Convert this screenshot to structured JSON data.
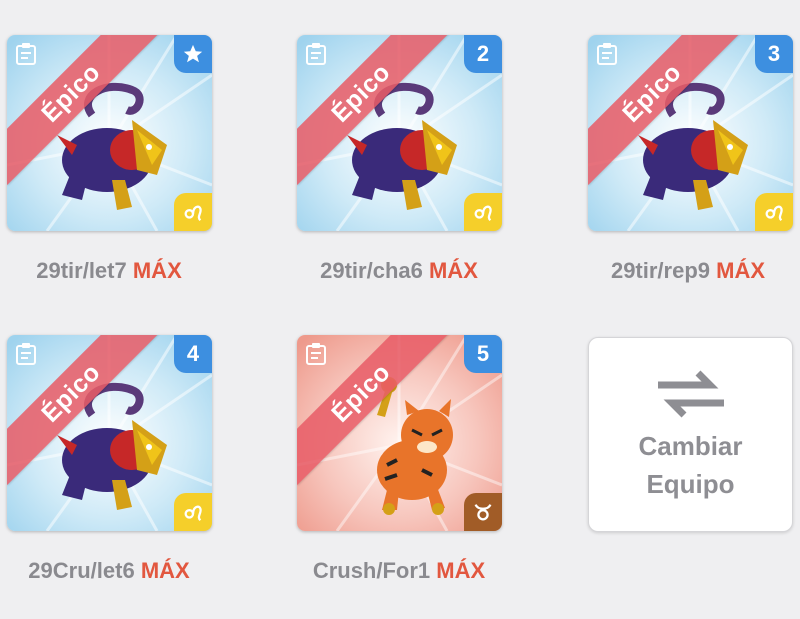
{
  "cards": [
    {
      "rarity": "Épico",
      "badge_type": "star",
      "badge_text": "",
      "element": "leo",
      "name": "29tir/let7",
      "level": "MÁX",
      "theme": "blue",
      "creature": "dark-panther"
    },
    {
      "rarity": "Épico",
      "badge_type": "number",
      "badge_text": "2",
      "element": "leo",
      "name": "29tir/cha6",
      "level": "MÁX",
      "theme": "blue",
      "creature": "dark-panther"
    },
    {
      "rarity": "Épico",
      "badge_type": "number",
      "badge_text": "3",
      "element": "leo",
      "name": "29tir/rep9",
      "level": "MÁX",
      "theme": "blue",
      "creature": "dark-panther"
    },
    {
      "rarity": "Épico",
      "badge_type": "number",
      "badge_text": "4",
      "element": "leo",
      "name": "29Cru/let6",
      "level": "MÁX",
      "theme": "blue",
      "creature": "dark-panther"
    },
    {
      "rarity": "Épico",
      "badge_type": "number",
      "badge_text": "5",
      "element": "taurus",
      "name": "Crush/For1",
      "level": "MÁX",
      "theme": "red",
      "creature": "tiger-cub"
    }
  ],
  "swap_button": {
    "line1": "Cambiar",
    "line2": "Equipo",
    "icon": "swap-arrows-icon"
  },
  "colors": {
    "background": "#efeff1",
    "label_gray": "#8a8a8f",
    "max_red": "#e2573f",
    "ribbon": "#e85c66",
    "corner_blue": "#3d8fe0",
    "corner_gold": "#f5cf2a",
    "corner_brown": "#a15c27"
  }
}
